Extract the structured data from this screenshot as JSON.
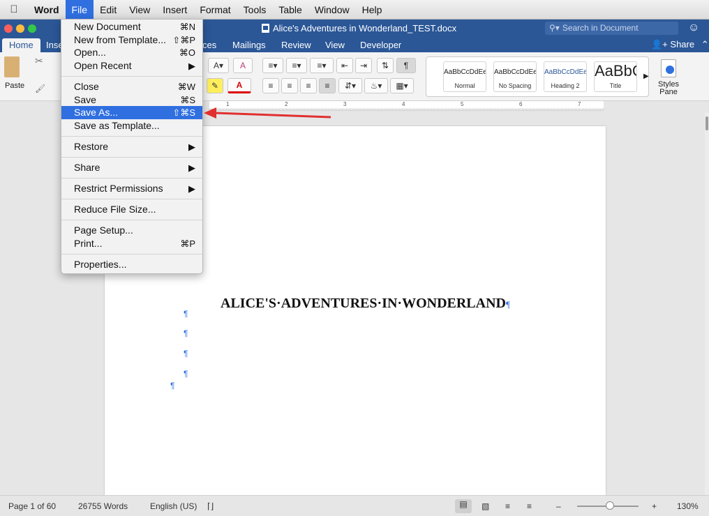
{
  "menubar": {
    "app": "Word",
    "items": [
      "File",
      "Edit",
      "View",
      "Insert",
      "Format",
      "Tools",
      "Table",
      "Window",
      "Help"
    ],
    "active": "File"
  },
  "window": {
    "title": "Alice's Adventures in Wonderland_TEST.docx",
    "search_placeholder": "Search in Document"
  },
  "tabs": {
    "home": "Home",
    "insert": "Inse",
    "references": "ces",
    "mailings": "Mailings",
    "review": "Review",
    "view": "View",
    "developer": "Developer",
    "share": "Share"
  },
  "ribbon": {
    "paste": "Paste",
    "styles_pane": "Styles Pane",
    "styles": [
      {
        "sample": "AaBbCcDdEe",
        "name": "Normal"
      },
      {
        "sample": "AaBbCcDdEe",
        "name": "No Spacing"
      },
      {
        "sample": "AaBbCcDdEe",
        "name": "Heading 2"
      },
      {
        "sample": "AaBbC",
        "name": "Title"
      }
    ]
  },
  "file_menu": {
    "items": [
      {
        "label": "New Document",
        "shortcut": "⌘N"
      },
      {
        "label": "New from Template...",
        "shortcut": "⇧⌘P"
      },
      {
        "label": "Open...",
        "shortcut": "⌘O"
      },
      {
        "label": "Open Recent",
        "shortcut": "▶"
      },
      {
        "label": "Close",
        "shortcut": "⌘W"
      },
      {
        "label": "Save",
        "shortcut": "⌘S"
      },
      {
        "label": "Save As...",
        "shortcut": "⇧⌘S"
      },
      {
        "label": "Save as Template...",
        "shortcut": ""
      },
      {
        "label": "Restore",
        "shortcut": "▶"
      },
      {
        "label": "Share",
        "shortcut": "▶"
      },
      {
        "label": "Restrict Permissions",
        "shortcut": "▶"
      },
      {
        "label": "Reduce File Size...",
        "shortcut": ""
      },
      {
        "label": "Page Setup...",
        "shortcut": ""
      },
      {
        "label": "Print...",
        "shortcut": "⌘P"
      },
      {
        "label": "Properties...",
        "shortcut": ""
      }
    ],
    "highlighted": "Save As..."
  },
  "document": {
    "heading": "ALICE'S·ADVENTURES·IN·WONDERLAND",
    "pilcrow": "¶"
  },
  "ruler": {
    "marks": [
      "1",
      "2",
      "3",
      "4",
      "5",
      "6",
      "7"
    ]
  },
  "status": {
    "page": "Page 1 of 60",
    "words": "26755 Words",
    "language": "English (US)",
    "zoom": "130%"
  },
  "colors": {
    "word_blue": "#2b5797",
    "highlight": "#2f6fe0",
    "arrow": "#e03030"
  }
}
